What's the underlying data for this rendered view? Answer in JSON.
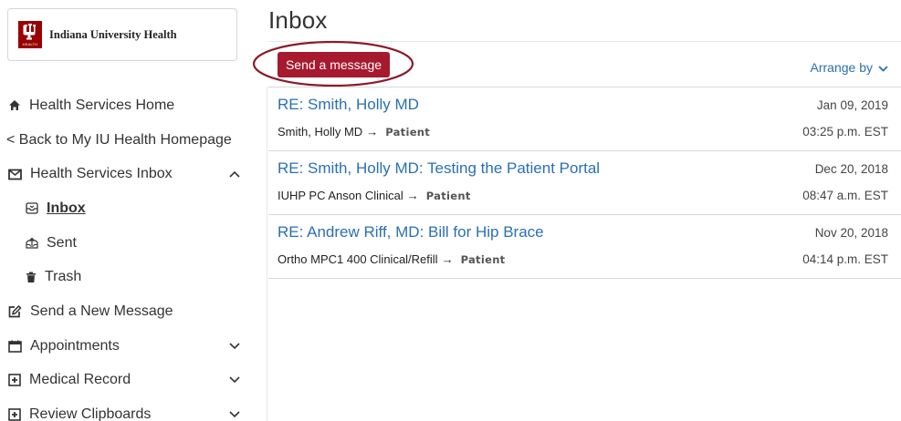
{
  "brand": {
    "name": "Indiana University Health",
    "mark_text": "HEALTH",
    "accent": "#a6192e",
    "link_color": "#2a6fb5"
  },
  "sidebar": {
    "items": [
      {
        "label": "Health Services Home",
        "icon": "home-icon"
      },
      {
        "label": "< Back to My IU Health Homepage"
      },
      {
        "label": "Health Services Inbox",
        "icon": "envelope-icon",
        "expanded": true
      },
      {
        "label": "Inbox",
        "icon": "inbox-icon",
        "active": true
      },
      {
        "label": "Sent",
        "icon": "sent-icon"
      },
      {
        "label": "Trash",
        "icon": "trash-icon"
      },
      {
        "label": "Send a New Message",
        "icon": "compose-icon"
      },
      {
        "label": "Appointments",
        "icon": "calendar-icon"
      },
      {
        "label": "Medical Record",
        "icon": "medical-record-icon"
      },
      {
        "label": "Review Clipboards",
        "icon": "clipboard-icon"
      }
    ]
  },
  "main": {
    "title": "Inbox",
    "send_button": "Send a message",
    "arrange_label": "Arrange by",
    "messages": [
      {
        "subject": "RE: Smith, Holly MD",
        "from": "Smith, Holly MD",
        "arrow": "→",
        "to": "Patient",
        "date": "Jan 09, 2019",
        "time": "03:25 p.m. EST"
      },
      {
        "subject": "RE: Smith, Holly MD: Testing the Patient Portal",
        "from": "IUHP PC Anson Clinical",
        "arrow": "→",
        "to": "Patient",
        "date": "Dec 20, 2018",
        "time": "08:47 a.m. EST"
      },
      {
        "subject": "RE: Andrew Riff, MD: Bill for Hip Brace",
        "from": "Ortho MPC1 400 Clinical/Refill",
        "arrow": "→",
        "to": "Patient",
        "date": "Nov 20, 2018",
        "time": "04:14 p.m. EST"
      }
    ]
  }
}
